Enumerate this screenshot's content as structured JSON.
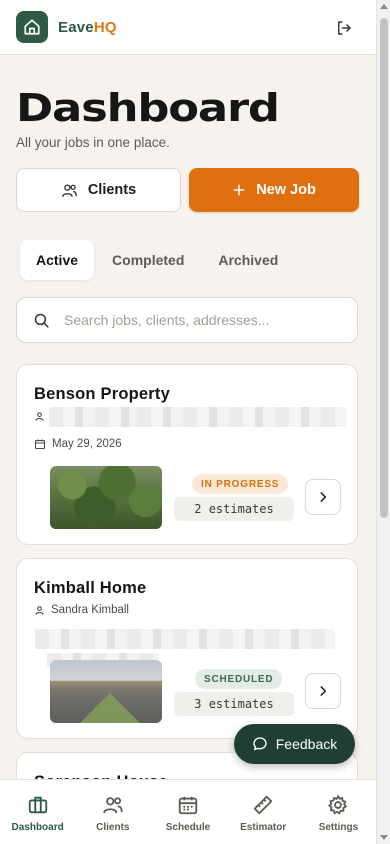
{
  "app": {
    "brand_part1": "Eave",
    "brand_part2": "HQ",
    "brand_color": "#2f5a46",
    "accent_color": "#e0700f"
  },
  "header": {
    "title": "Dashboard",
    "subtitle": "All your jobs in one place."
  },
  "actions": {
    "clients_label": "Clients",
    "new_job_label": "New Job"
  },
  "tabs": [
    {
      "label": "Active",
      "active": true
    },
    {
      "label": "Completed",
      "active": false
    },
    {
      "label": "Archived",
      "active": false
    }
  ],
  "search": {
    "placeholder": "Search jobs, clients, addresses...",
    "value": ""
  },
  "jobs": [
    {
      "title": "Benson Property",
      "date": "May 29, 2026",
      "status": "IN PROGRESS",
      "estimates": "2 estimates"
    },
    {
      "title": "Kimball Home",
      "client": "Sandra Kimball",
      "status": "SCHEDULED",
      "estimates": "3 estimates"
    },
    {
      "title": "Sorenson House"
    }
  ],
  "feedback_label": "Feedback",
  "nav": [
    {
      "label": "Dashboard",
      "icon": "briefcase-icon",
      "active": true
    },
    {
      "label": "Clients",
      "icon": "users-icon",
      "active": false
    },
    {
      "label": "Schedule",
      "icon": "calendar-icon",
      "active": false
    },
    {
      "label": "Estimator",
      "icon": "ruler-icon",
      "active": false
    },
    {
      "label": "Settings",
      "icon": "gear-icon",
      "active": false
    }
  ]
}
